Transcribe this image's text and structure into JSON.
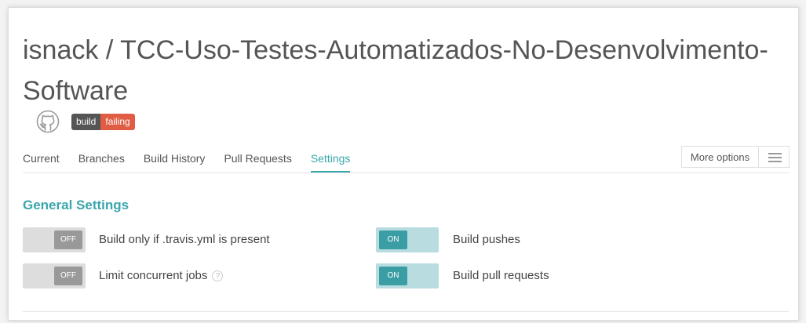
{
  "repo": {
    "title": "isnack / TCC-Uso-Testes-Automatizados-No-Desenvolvimento-Software"
  },
  "badge": {
    "left": "build",
    "right": "failing"
  },
  "tabs": [
    {
      "label": "Current"
    },
    {
      "label": "Branches"
    },
    {
      "label": "Build History"
    },
    {
      "label": "Pull Requests"
    },
    {
      "label": "Settings",
      "active": true
    }
  ],
  "toolbar": {
    "more_options": "More options"
  },
  "general_settings": {
    "title": "General Settings",
    "items": [
      {
        "label": "Build only if .travis.yml is present",
        "state": "OFF"
      },
      {
        "label": "Limit concurrent jobs",
        "state": "OFF",
        "help": "?"
      },
      {
        "label": "Build pushes",
        "state": "ON"
      },
      {
        "label": "Build pull requests",
        "state": "ON"
      }
    ]
  },
  "colors": {
    "accent": "#39a6ac",
    "badge_failing": "#e05d44",
    "toggle_on": "#3b9ea4",
    "toggle_off": "#999999"
  }
}
